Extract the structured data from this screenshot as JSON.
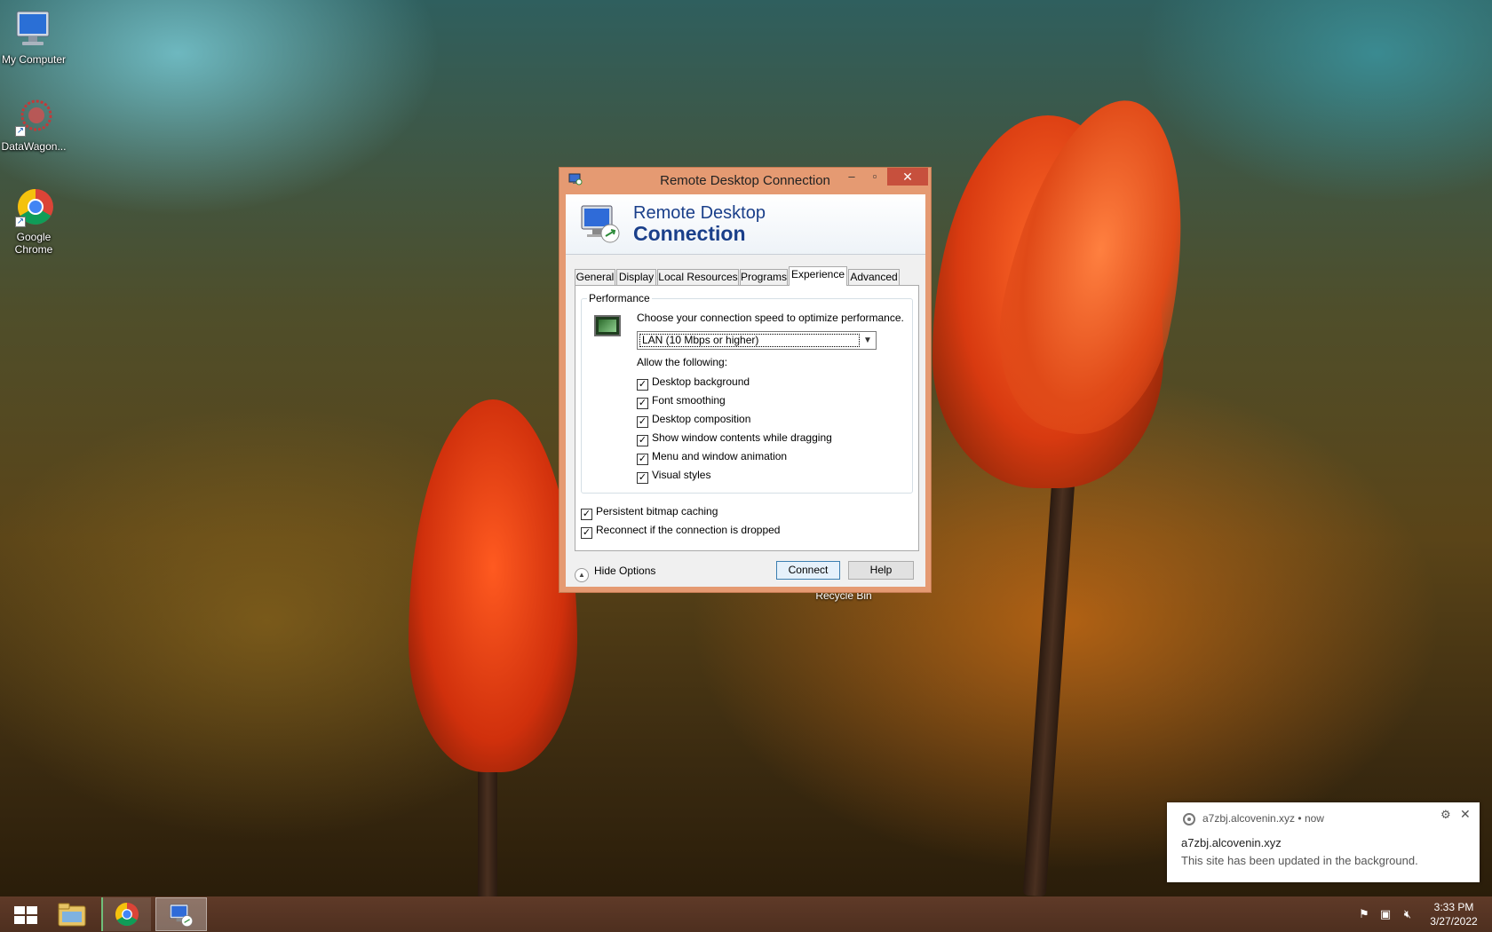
{
  "desktop": {
    "icons": [
      {
        "label": "My Computer"
      },
      {
        "label": "DataWagon..."
      },
      {
        "label": "Google Chrome"
      }
    ],
    "recycle_bin_label": "Recycle Bin"
  },
  "window": {
    "title": "Remote Desktop Connection",
    "minimize_glyph": "–",
    "maximize_glyph": "▫",
    "close_glyph": "✕",
    "banner_line1": "Remote Desktop",
    "banner_line2": "Connection",
    "tabs": [
      {
        "label": "General",
        "active": false
      },
      {
        "label": "Display",
        "active": false
      },
      {
        "label": "Local Resources",
        "active": false
      },
      {
        "label": "Programs",
        "active": false
      },
      {
        "label": "Experience",
        "active": true
      },
      {
        "label": "Advanced",
        "active": false
      }
    ],
    "performance": {
      "group_label": "Performance",
      "speed_prompt": "Choose your connection speed to optimize performance.",
      "speed_value": "LAN (10 Mbps or higher)",
      "allow_label": "Allow the following:",
      "options": [
        {
          "label": "Desktop background",
          "checked": true
        },
        {
          "label": "Font smoothing",
          "checked": true
        },
        {
          "label": "Desktop composition",
          "checked": true
        },
        {
          "label": "Show window contents while dragging",
          "checked": true
        },
        {
          "label": "Menu and window animation",
          "checked": true
        },
        {
          "label": "Visual styles",
          "checked": true
        }
      ]
    },
    "extra_options": [
      {
        "label": "Persistent bitmap caching",
        "checked": true
      },
      {
        "label": "Reconnect if the connection is dropped",
        "checked": true
      }
    ],
    "hide_options_label": "Hide Options",
    "connect_label": "Connect",
    "help_label": "Help",
    "check_glyph": "✓"
  },
  "notification": {
    "source": "a7zbj.alcovenin.xyz",
    "separator": "•",
    "time": "now",
    "heading": "a7zbj.alcovenin.xyz",
    "body": "This site has been updated in the background.",
    "gear_glyph": "⚙",
    "close_glyph": "✕"
  },
  "taskbar": {
    "clock_time": "3:33 PM",
    "clock_date": "3/27/2022",
    "tray_icons": [
      "flag-icon",
      "network-icon",
      "volume-muted-icon"
    ]
  },
  "colors": {
    "window_frame": "#e59a72",
    "close_button": "#c7503d",
    "banner_text": "#1a3f8a",
    "taskbar": "#5f3a28"
  }
}
